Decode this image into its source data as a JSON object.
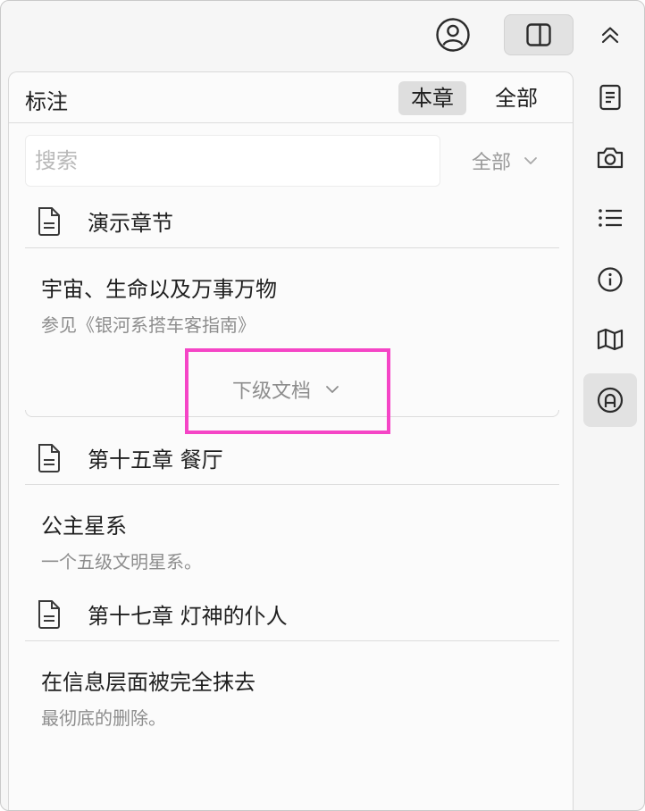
{
  "toolbar": {
    "account_icon": "person-circle-icon",
    "sidebar_icon": "sidebar-right-icon",
    "collapse_icon": "chevron-up-double-icon"
  },
  "panel": {
    "title": "标注",
    "segments": [
      {
        "label": "本章",
        "selected": true
      },
      {
        "label": "全部",
        "selected": false
      }
    ],
    "search": {
      "placeholder": "搜索",
      "value": ""
    },
    "filter": {
      "label": "全部"
    }
  },
  "sections": [
    {
      "chapter": "演示章节",
      "notes": [
        {
          "title": "宇宙、生命以及万事万物",
          "desc": "参见《银河系搭车客指南》",
          "subdocs_label": "下级文档"
        }
      ]
    },
    {
      "chapter": "第十五章 餐厅",
      "notes": [
        {
          "title": "公主星系",
          "desc": "一个五级文明星系。"
        }
      ]
    },
    {
      "chapter": "第十七章 灯神的仆人",
      "notes": [
        {
          "title": "在信息层面被完全抹去",
          "desc": "最彻底的删除。"
        }
      ]
    }
  ],
  "rail": [
    {
      "icon": "document-icon",
      "active": false
    },
    {
      "icon": "camera-icon",
      "active": false
    },
    {
      "icon": "list-icon",
      "active": false
    },
    {
      "icon": "info-icon",
      "active": false
    },
    {
      "icon": "map-icon",
      "active": false
    },
    {
      "icon": "annotation-icon",
      "active": true
    }
  ],
  "colors": {
    "highlight": "#f545c6",
    "active_bg": "#e2e2e2"
  }
}
